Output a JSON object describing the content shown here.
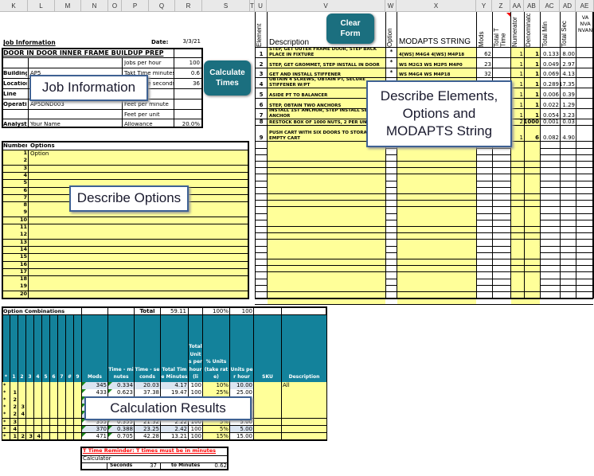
{
  "columns": [
    [
      "K",
      0,
      35
    ],
    [
      "L",
      35,
      69
    ],
    [
      "M",
      69,
      102
    ],
    [
      "N",
      102,
      136
    ],
    [
      "O",
      136,
      153
    ],
    [
      "P",
      153,
      187
    ],
    [
      "Q",
      187,
      220
    ],
    [
      "R",
      220,
      254
    ],
    [
      "S",
      254,
      314
    ],
    [
      "T",
      314,
      320
    ],
    [
      "U",
      320,
      335
    ],
    [
      "V",
      335,
      484
    ],
    [
      "W",
      484,
      498
    ],
    [
      "X",
      498,
      598
    ],
    [
      "Y",
      598,
      618
    ],
    [
      "Z",
      618,
      641
    ],
    [
      "AA",
      641,
      658
    ],
    [
      "AB",
      658,
      678
    ],
    [
      "AC",
      678,
      703
    ],
    [
      "AD",
      703,
      723
    ],
    [
      "AE",
      723,
      746
    ]
  ],
  "job": {
    "heading": "Job Information",
    "date_label": "Date:",
    "date": "3/3/21",
    "title": "DOOR IN DOOR INNER FRAME BUILDUP PREP",
    "left_rows": [
      {
        "label": "",
        "value": ""
      },
      {
        "label": "Building",
        "value": "AP5"
      },
      {
        "label": "Location",
        "value": ""
      },
      {
        "label": "Line",
        "value": ""
      },
      {
        "label": "Operation",
        "value": "AP5DND003"
      },
      {
        "label": "",
        "value": ""
      },
      {
        "label": "Analyst",
        "value": "Your Name"
      }
    ],
    "right_rows": [
      {
        "label": "Jobs per hour",
        "value": "100"
      },
      {
        "label": "Takt Time minutes",
        "value": "0.6"
      },
      {
        "label": "Takt Time seconds",
        "value": "36"
      },
      {
        "label": "",
        "value": ""
      },
      {
        "label": "Feet per minute",
        "value": ""
      },
      {
        "label": "Feet per unit",
        "value": ""
      },
      {
        "label": "Allowance",
        "value": "20.0%"
      }
    ]
  },
  "buttons": {
    "calculate": "Calculate Times",
    "clear": "Clear Form"
  },
  "callouts": {
    "job": "Job Information",
    "elements": "Describe Elements, Options and MODAPTS String",
    "options": "Describe Options",
    "results": "Calculation Results"
  },
  "elements": {
    "headers": {
      "element": "Element",
      "description": "Description",
      "option": "Option",
      "modapts": "MODAPTS STRING",
      "mods": "Mods",
      "total_t": "Total T Time",
      "numerator": "Numerator",
      "denominator": "Denominator",
      "total_min": "Total Min",
      "total_sec": "Total Sec",
      "va": "VA NVA NVAN"
    },
    "rows": [
      {
        "n": "1",
        "desc": "STEP, GET OUTER FRAME DOOR, STEP BACK PLACE IN FIXTURE",
        "opt": "*",
        "str": "4[WS] M4G4 4[WS] M4P18",
        "mods": "62",
        "num": "1",
        "den": "1",
        "min": "0.133",
        "sec": "8.00"
      },
      {
        "n": "2",
        "desc": "STEP, GET GROMMET, STEP INSTALL IN DOOR",
        "opt": "*",
        "str": "WS M2G3 WS M2P5 M4P0",
        "mods": "23",
        "num": "1",
        "den": "1",
        "min": "0.049",
        "sec": "2.97"
      },
      {
        "n": "3",
        "desc": "GET AND INSTALL STIFFENER",
        "opt": "*",
        "str": "WS M4G4 WS M4P18",
        "mods": "32",
        "num": "1",
        "den": "1",
        "min": "0.069",
        "sec": "4.13"
      },
      {
        "n": "4",
        "desc": "OBTAIN 4 SCREWS, OBTAIN PT, SECURE STIFFENER W/PT",
        "opt": "",
        "str": "",
        "mods": "",
        "num": "1",
        "den": "1",
        "min": "0.289",
        "sec": "17.35"
      },
      {
        "n": "5",
        "desc": "ASIDE PT TO BALANCER",
        "opt": "",
        "str": "",
        "mods": "",
        "num": "1",
        "den": "1",
        "min": "0.006",
        "sec": "0.39"
      },
      {
        "n": "6",
        "desc": "STEP, OBTAIN TWO ANCHORS",
        "opt": "",
        "str": "",
        "mods": "",
        "num": "1",
        "den": "1",
        "min": "0.022",
        "sec": "1.29"
      },
      {
        "n": "7",
        "desc": "INSTALL 1ST ANCHOR, STEP INSTALL SECOND ANCHOR",
        "opt": "",
        "str": "",
        "mods": "",
        "num": "1",
        "den": "1",
        "min": "0.054",
        "sec": "3.23"
      },
      {
        "n": "8",
        "desc": "RESTOCK BOX OF 1000 NUTS, 2 PER UNIT",
        "opt": "",
        "str": "",
        "mods": "",
        "num": "2",
        "den": "1000",
        "min": "0.001",
        "sec": "0.03"
      },
      {
        "n": "9",
        "desc": "PUSH CART WITH SIX DOORS TO STORAGE, R EMPTY CART",
        "opt": "",
        "str": "",
        "mods": "",
        "num": "1",
        "den": "6",
        "min": "0.082",
        "sec": "4.90"
      }
    ]
  },
  "options": {
    "number_header": "Number",
    "options_header": "Options",
    "rows": [
      "Option",
      "",
      "",
      "",
      "",
      "",
      "",
      "",
      "",
      "",
      "",
      "",
      "",
      "",
      "",
      "",
      "",
      "",
      "",
      ""
    ]
  },
  "combos": {
    "title": "Option Combinations",
    "total_label": "Total",
    "total_value": "59.11",
    "pct_total": "100%",
    "units_total": "100",
    "headers": [
      "*",
      "1",
      "2",
      "3",
      "4",
      "5",
      "6",
      "7",
      "#",
      "9",
      "Mods",
      "Time - minutes",
      "Time - seconds",
      "Total Time Minutes",
      "Total Units per hour (li",
      "% Units (take rate)",
      "Units per hour",
      "SKU",
      "Description"
    ],
    "rows": [
      [
        "*",
        "",
        "",
        "",
        "",
        "",
        "",
        "",
        "",
        "",
        "345",
        "0.334",
        "20.03",
        "4.17",
        "100",
        "10%",
        "10.00",
        "",
        "All"
      ],
      [
        "*",
        "1",
        "",
        "",
        "",
        "",
        "",
        "",
        "",
        "",
        "433",
        "0.623",
        "37.38",
        "19.47",
        "100",
        "25%",
        "25.00",
        "",
        ""
      ],
      [
        "*",
        "2",
        "",
        "",
        "",
        "",
        "",
        "",
        "",
        "",
        "",
        "",
        "",
        "",
        "",
        "",
        "",
        "",
        ""
      ],
      [
        "*",
        "2",
        "3",
        "",
        "",
        "",
        "",
        "",
        "",
        "",
        "",
        "",
        "",
        "",
        "",
        "",
        "",
        "",
        ""
      ],
      [
        "*",
        "2",
        "4",
        "",
        "",
        "",
        "",
        "",
        "",
        "",
        "",
        "",
        "",
        "",
        "",
        "",
        "",
        "",
        ""
      ],
      [
        "*",
        "3",
        "",
        "",
        "",
        "",
        "",
        "",
        "",
        "",
        "355",
        "0.355",
        "21.32",
        "2.22",
        "100",
        "5%",
        "5.00",
        "",
        ""
      ],
      [
        "*",
        "4",
        "",
        "",
        "",
        "",
        "",
        "",
        "",
        "",
        "370",
        "0.388",
        "23.25",
        "2.42",
        "100",
        "5%",
        "5.00",
        "",
        ""
      ],
      [
        "*",
        "1",
        "2",
        "3",
        "4",
        "",
        "",
        "",
        "",
        "",
        "471",
        "0.705",
        "42.28",
        "13.21",
        "100",
        "15%",
        "15.00",
        "",
        ""
      ]
    ]
  },
  "reminder": {
    "title": "T Time Reminder: T times must be in minutes",
    "calculator": "Calculator",
    "seconds_label": "Seconds",
    "seconds_value": "37",
    "to_minutes_label": "to Minutes",
    "minutes_value": "0.62"
  },
  "colors": {
    "teal_header": "#13829b",
    "button": "#1b6f7f",
    "input_yellow": "#ffff99",
    "callout_border": "#3e6193",
    "reminder_red": "#ff0000"
  }
}
